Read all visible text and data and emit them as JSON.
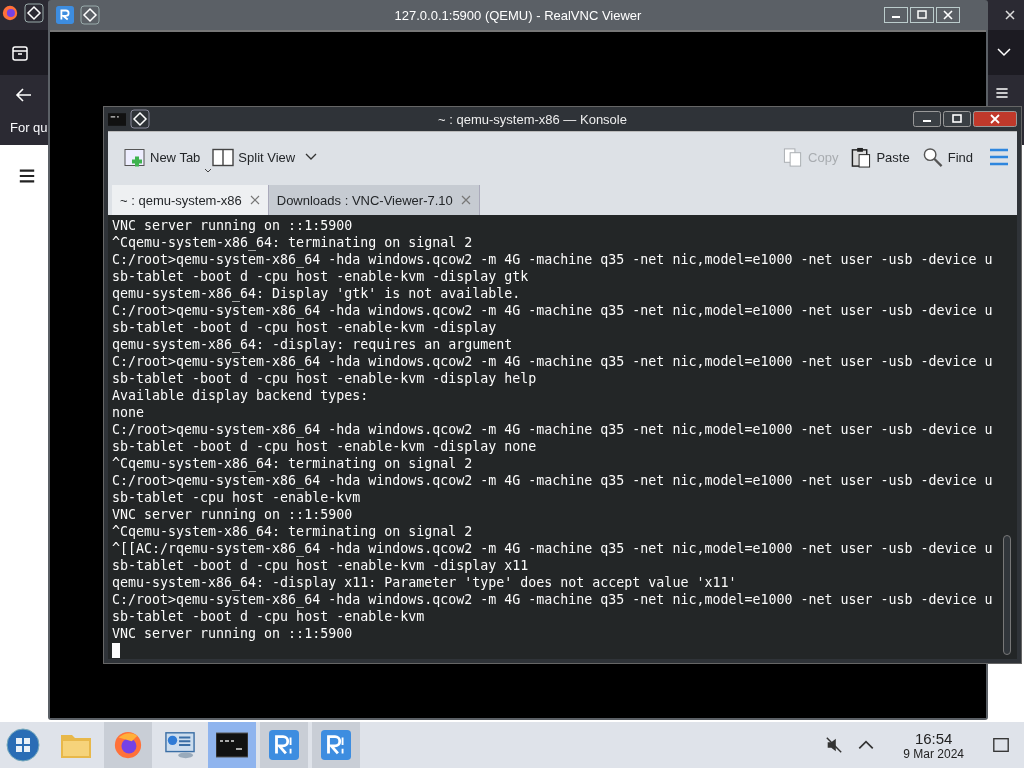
{
  "browser": {
    "sidebar_text": "For qu"
  },
  "vnc_viewer": {
    "title": "127.0.0.1:5900 (QEMU) - RealVNC Viewer"
  },
  "konsole": {
    "title": "~ : qemu-system-x86 — Konsole",
    "toolbar_left": [
      {
        "kind": "new-tab",
        "label": "New Tab",
        "disabled": false
      },
      {
        "kind": "split-view",
        "label": "Split View",
        "disabled": false
      }
    ],
    "toolbar_right": [
      {
        "kind": "copy",
        "label": "Copy",
        "disabled": true
      },
      {
        "kind": "paste",
        "label": "Paste",
        "disabled": false
      },
      {
        "kind": "find",
        "label": "Find",
        "disabled": false
      }
    ],
    "tabs": [
      {
        "label": "~ : qemu-system-x86",
        "selected": true
      },
      {
        "label": "Downloads : VNC-Viewer-7.10",
        "selected": false
      }
    ],
    "terminal_lines": [
      "VNC server running on ::1:5900",
      "^Cqemu-system-x86_64: terminating on signal 2",
      "C:/root>qemu-system-x86_64 -hda windows.qcow2 -m 4G -machine q35 -net nic,model=e1000 -net user -usb -device u",
      "sb-tablet -boot d -cpu host -enable-kvm -display gtk",
      "qemu-system-x86_64: Display 'gtk' is not available.",
      "C:/root>qemu-system-x86_64 -hda windows.qcow2 -m 4G -machine q35 -net nic,model=e1000 -net user -usb -device u",
      "sb-tablet -boot d -cpu host -enable-kvm -display",
      "qemu-system-x86_64: -display: requires an argument",
      "C:/root>qemu-system-x86_64 -hda windows.qcow2 -m 4G -machine q35 -net nic,model=e1000 -net user -usb -device u",
      "sb-tablet -boot d -cpu host -enable-kvm -display help",
      "Available display backend types:",
      "none",
      "C:/root>qemu-system-x86_64 -hda windows.qcow2 -m 4G -machine q35 -net nic,model=e1000 -net user -usb -device u",
      "sb-tablet -boot d -cpu host -enable-kvm -display none",
      "^Cqemu-system-x86_64: terminating on signal 2",
      "C:/root>qemu-system-x86_64 -hda windows.qcow2 -m 4G -machine q35 -net nic,model=e1000 -net user -usb -device u",
      "sb-tablet -cpu host -enable-kvm",
      "VNC server running on ::1:5900",
      "^Cqemu-system-x86_64: terminating on signal 2",
      "^[[AC:/rqemu-system-x86_64 -hda windows.qcow2 -m 4G -machine q35 -net nic,model=e1000 -net user -usb -device u",
      "sb-tablet -boot d -cpu host -enable-kvm -display x11",
      "qemu-system-x86_64: -display x11: Parameter 'type' does not accept value 'x11'",
      "C:/root>qemu-system-x86_64 -hda windows.qcow2 -m 4G -machine q35 -net nic,model=e1000 -net user -usb -device u",
      "sb-tablet -boot d -cpu host -enable-kvm",
      "VNC server running on ::1:5900"
    ]
  },
  "taskbar": {
    "apps": [
      {
        "kind": "folder",
        "open": false,
        "selected": false
      },
      {
        "kind": "browser",
        "open": true,
        "selected": false
      },
      {
        "kind": "monitor",
        "open": false,
        "selected": false
      },
      {
        "kind": "terminal",
        "open": true,
        "selected": true
      },
      {
        "kind": "vnc",
        "open": true,
        "selected": false
      },
      {
        "kind": "vnc",
        "open": true,
        "selected": false
      }
    ],
    "clock": {
      "time": "16:54",
      "date": "9 Mar 2024"
    }
  }
}
